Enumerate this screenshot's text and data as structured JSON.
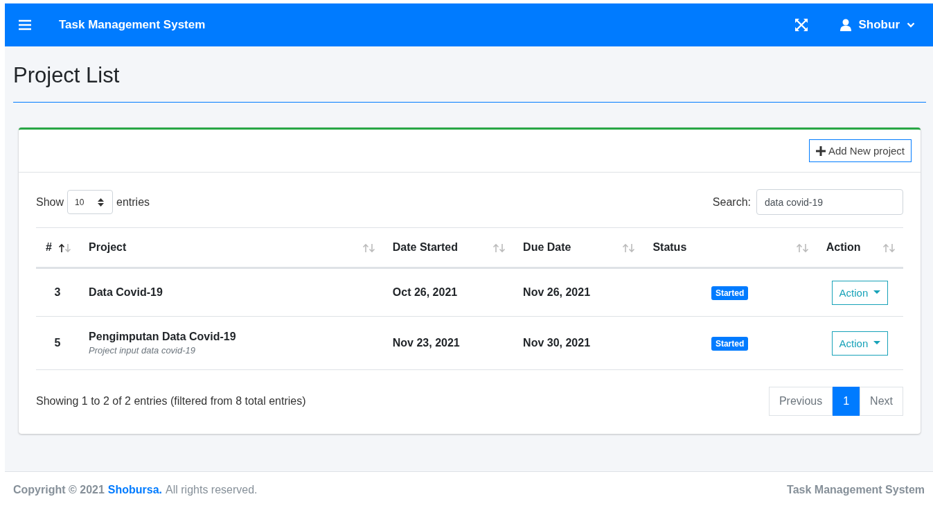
{
  "navbar": {
    "title": "Task Management System",
    "user": "Shobur"
  },
  "page_title": "Project List",
  "card": {
    "add_button": "Add New project",
    "length": {
      "before": "Show",
      "value": "10",
      "after": "entries"
    },
    "search": {
      "label": "Search:",
      "value": "data covid-19"
    },
    "columns": [
      {
        "label": "#",
        "sorted": true
      },
      {
        "label": "Project",
        "sorted": false
      },
      {
        "label": "Date Started",
        "sorted": false
      },
      {
        "label": "Due Date",
        "sorted": false
      },
      {
        "label": "Status",
        "sorted": false
      },
      {
        "label": "Action",
        "sorted": false
      }
    ],
    "rows": [
      {
        "number": "3",
        "project": "Data Covid-19",
        "date_started": "Oct 26, 2021",
        "due_date": "Nov 26, 2021",
        "status": "Started",
        "action": "Action"
      },
      {
        "number": "5",
        "project": "Pengimputan Data Covid-19",
        "description": "Project input data covid-19",
        "date_started": "Nov 23, 2021",
        "due_date": "Nov 30, 2021",
        "status": "Started",
        "action": "Action"
      }
    ],
    "info": "Showing 1 to 2 of 2 entries (filtered from 8 total entries)",
    "pagination": [
      {
        "label": "Previous",
        "selected": false
      },
      {
        "label": "1",
        "selected": true
      },
      {
        "label": "Next",
        "selected": false
      }
    ]
  },
  "footer": {
    "prefix": "Copyright © 2021",
    "link": "Shobursa.",
    "suffix": "All rights reserved.",
    "right": "Task Management System"
  }
}
